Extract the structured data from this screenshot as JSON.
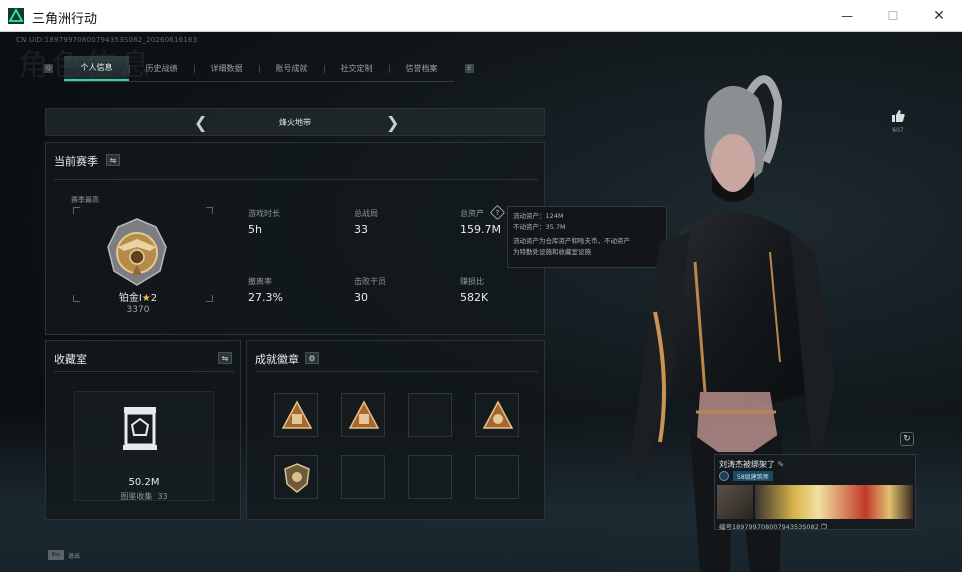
{
  "window": {
    "title": "三角洲行动",
    "controls": {
      "minimize": "—",
      "maximize": "☐",
      "close": "✕"
    }
  },
  "header": {
    "uid": "CN UID:18979970800794353S082_20260616163",
    "watermark": "角色信息"
  },
  "tabs": [
    {
      "label": "个人信息",
      "active": true
    },
    {
      "label": "历史战绩",
      "active": false
    },
    {
      "label": "详细数据",
      "active": false
    },
    {
      "label": "账号成就",
      "active": false
    },
    {
      "label": "社交定制",
      "active": false
    },
    {
      "label": "信誉档案",
      "active": false
    }
  ],
  "tab_nav": {
    "prev": "Q",
    "next": "E"
  },
  "mode": {
    "label": "烽火地带",
    "prev_icon": "chevron-left-icon",
    "next_icon": "chevron-right-icon"
  },
  "season": {
    "title": "当前赛季",
    "sub": "赛季最高",
    "rank_name": "铂金I",
    "rank_stars": "2",
    "rank_points": "3370",
    "stats": [
      {
        "label": "游戏时长",
        "value": "5h"
      },
      {
        "label": "总战局",
        "value": "33"
      },
      {
        "label": "总资产",
        "value": "159.7M"
      },
      {
        "label": "撤离率",
        "value": "27.3%"
      },
      {
        "label": "击败干员",
        "value": "30"
      },
      {
        "label": "赚损比",
        "value": "582K"
      }
    ]
  },
  "tooltip": {
    "line1": "流动资产：124M",
    "line2": "不动资产：35.7M",
    "line3": "流动资产为仓库资产和哈夫币，不动资产",
    "line4": "为特勤处设施和收藏室设施"
  },
  "collection": {
    "title": "收藏室",
    "value": "50.2M",
    "count_label": "图鉴收集",
    "count": "33"
  },
  "achievements": {
    "title": "成就徽章",
    "badges": [
      "badge-triangle-icon",
      "badge-triangle-icon",
      "",
      "badge-triangle-icon",
      "badge-shield-icon",
      "",
      "",
      ""
    ]
  },
  "like": {
    "count": "607"
  },
  "card": {
    "name": "刘涛杰被绑架了",
    "tag": "58级建筑师",
    "id": "编号18979970800794353S082"
  },
  "footer": {
    "key": "Esc",
    "label": "退出"
  },
  "colors": {
    "accent": "#37d3a4",
    "gold": "#c9a15a",
    "bg": "#0b0f12"
  }
}
